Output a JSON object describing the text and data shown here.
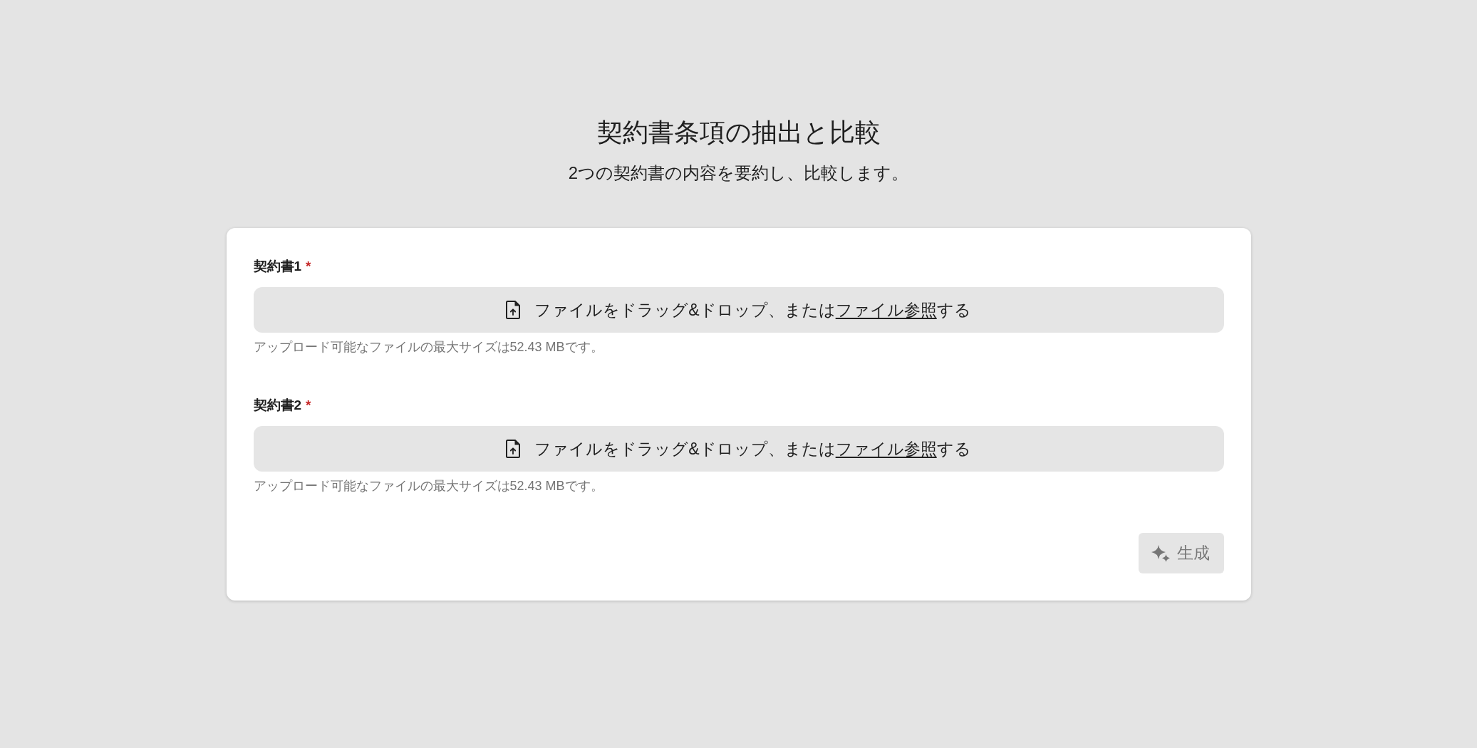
{
  "header": {
    "title": "契約書条項の抽出と比較",
    "subtitle": "2つの契約書の内容を要約し、比較します。"
  },
  "fields": [
    {
      "label": "契約書1",
      "required_mark": "*",
      "dropzone": {
        "text_before": "ファイルをドラッグ&ドロップ、または",
        "link": "ファイル参照",
        "text_after": "する"
      },
      "hint": "アップロード可能なファイルの最大サイズは52.43 MBです。"
    },
    {
      "label": "契約書2",
      "required_mark": "*",
      "dropzone": {
        "text_before": "ファイルをドラッグ&ドロップ、または",
        "link": "ファイル参照",
        "text_after": "する"
      },
      "hint": "アップロード可能なファイルの最大サイズは52.43 MBです。"
    }
  ],
  "submit_button": {
    "label": "生成",
    "disabled": true
  }
}
